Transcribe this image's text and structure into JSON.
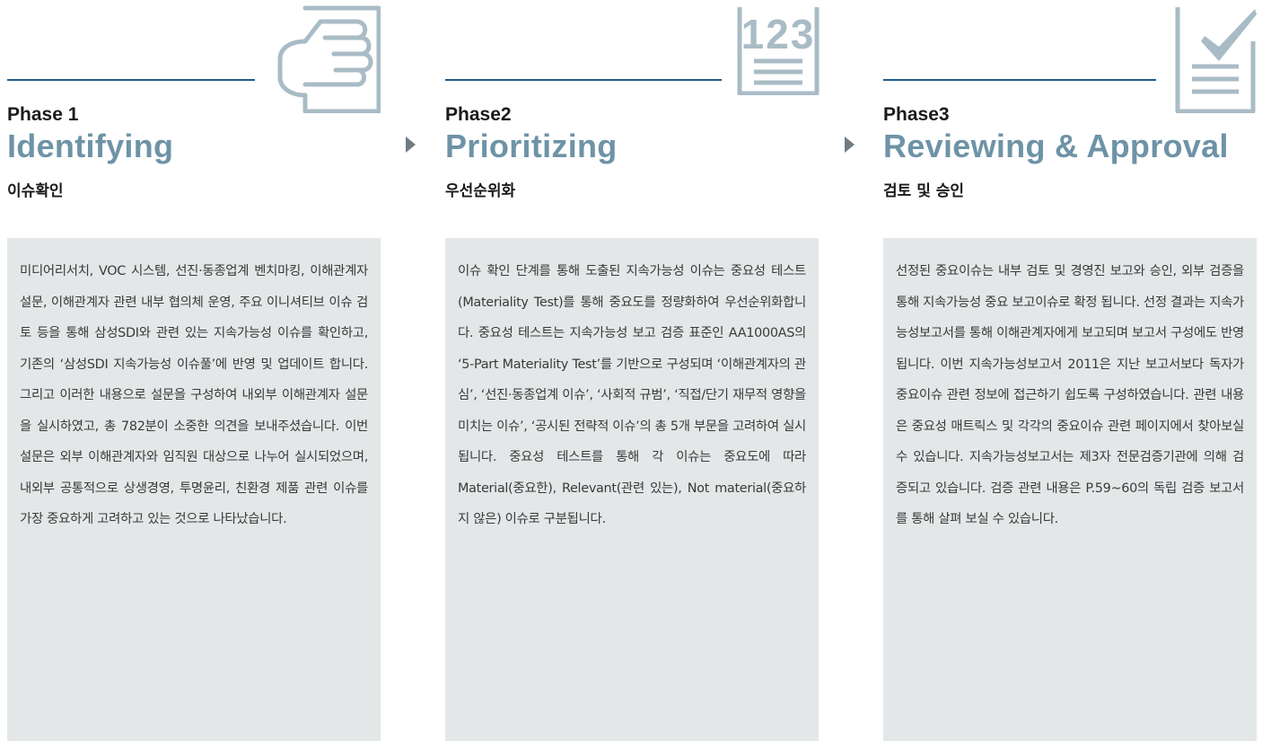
{
  "phases": [
    {
      "label": "Phase 1",
      "title": "Identifying",
      "subtitle": "이슈확인",
      "icon": "pointing-hand-icon",
      "body": "미디어리서치, VOC 시스템, 선진·동종업계 벤치마킹, 이해관계자 설문, 이해관계자 관련 내부 협의체 운영, 주요 이니셔티브 이슈 검토 등을 통해 삼성SDI와 관련 있는 지속가능성 이슈를 확인하고, 기존의 ‘삼성SDI 지속가능성 이슈풀’에 반영 및 업데이트 합니다. 그리고 이러한 내용으로 설문을 구성하여 내외부 이해관계자 설문을 실시하였고, 총 782분이 소중한 의견을 보내주셨습니다. 이번 설문은 외부 이해관계자와 임직원 대상으로 나누어 실시되었으며, 내외부 공통적으로 상생경영, 투명윤리, 친환경 제품 관련 이슈를 가장 중요하게 고려하고 있는 것으로 나타났습니다."
    },
    {
      "label": "Phase2",
      "title": "Prioritizing",
      "subtitle": "우선순위화",
      "icon": "numbered-list-icon",
      "icon_text": "123",
      "body": "이슈 확인 단계를 통해 도출된 지속가능성 이슈는 중요성 테스트(Materiality Test)를 통해 중요도를 정량화하여 우선순위화합니다. 중요성 테스트는 지속가능성 보고 검증 표준인 AA1000AS의 ‘5-Part Materiality Test’를 기반으로 구성되며 ‘이해관계자의 관심’, ‘선진·동종업계 이슈’, ‘사회적 규범’, ‘직접/단기 재무적 영향을 미치는 이슈’, ‘공시된 전략적 이슈’의 총 5개 부문을 고려하여 실시됩니다. 중요성 테스트를 통해 각 이슈는 중요도에 따라 Material(중요한), Relevant(관련 있는), Not material(중요하지 않은) 이슈로 구분됩니다."
    },
    {
      "label": "Phase3",
      "title": "Reviewing & Approval",
      "subtitle": "검토 및 승인",
      "icon": "checklist-icon",
      "body": "선정된 중요이슈는 내부 검토 및 경영진 보고와 승인, 외부 검증을 통해 지속가능성 중요 보고이슈로 확정 됩니다. 선정 결과는 지속가능성보고서를 통해 이해관계자에게 보고되며 보고서 구성에도 반영됩니다. 이번 지속가능성보고서 2011은 지난 보고서보다 독자가 중요이슈 관련 정보에 접근하기 쉽도록 구성하였습니다. 관련 내용은 중요성 매트릭스 및 각각의 중요이슈 관련 페이지에서 찾아보실 수 있습니다. 지속가능성보고서는 제3자 전문검증기관에 의해 검증되고 있습니다. 검증 관련 내용은 P.59~60의 독립 검증 보고서를 통해 살펴 보실 수 있습니다."
    }
  ],
  "colors": {
    "accent": "#6e93a6",
    "rule": "#215c8a",
    "box": "#e4e7e8",
    "icon": "#a9bcc6",
    "arrow": "#707b82"
  }
}
